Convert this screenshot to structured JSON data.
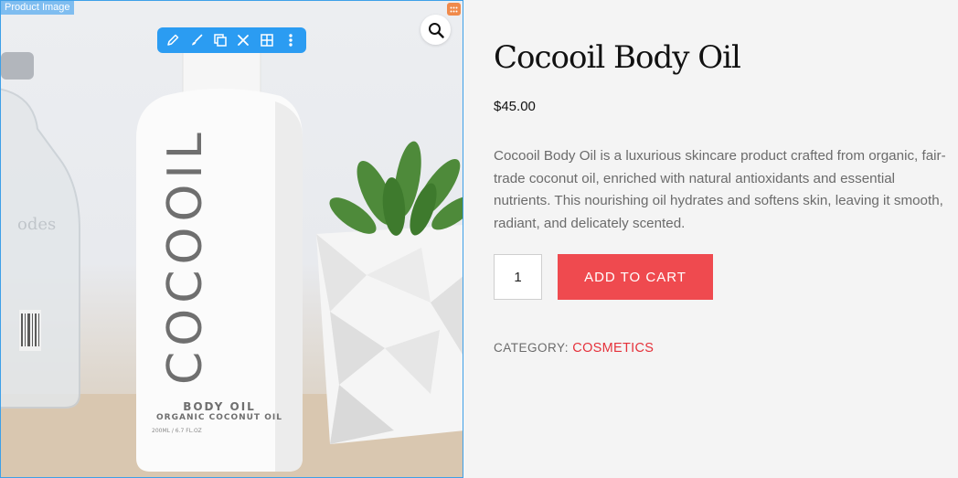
{
  "widget": {
    "tag_label": "Product Image",
    "handle_icon": "grid-handle-icon",
    "toolbar_icons": [
      "pencil-icon",
      "brush-icon",
      "duplicate-icon",
      "close-icon",
      "grid-icon",
      "more-vertical-icon"
    ],
    "zoom_icon": "search-icon",
    "accent_color": "#2b9cf2"
  },
  "bottle": {
    "brand": "COCOOIL",
    "line1": "BODY OIL",
    "line2": "ORGANIC COCONUT OIL",
    "line3": "200ML / 6.7 FL.OZ"
  },
  "product": {
    "title": "Cocooil Body Oil",
    "price": "$45.00",
    "description": "Cocooil Body Oil is a luxurious skincare product crafted from organic, fair-trade coconut oil, enriched with natural antioxidants and essential nutrients. This nourishing oil hydrates and softens skin, leaving it smooth, radiant, and delicately scented.",
    "quantity": "1",
    "add_to_cart_label": "ADD TO CART",
    "category_label": "CATEGORY:",
    "category_value": "COSMETICS",
    "button_color": "#ef4a4f",
    "link_color": "#e5323b"
  }
}
